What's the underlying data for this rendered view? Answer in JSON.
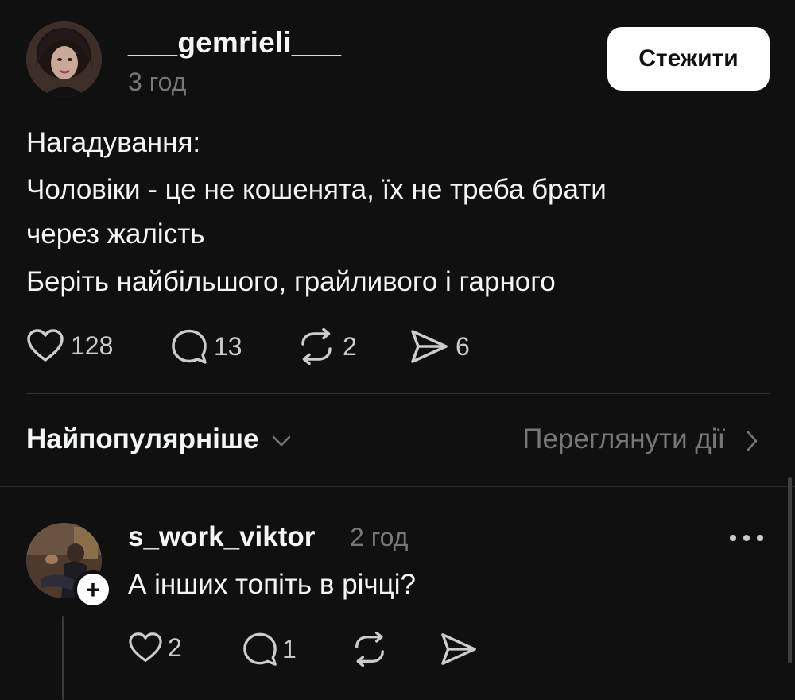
{
  "post": {
    "username": "___gemrieli___",
    "timestamp": "3 год",
    "follow_label": "Стежити",
    "lines": [
      "Нагадування:",
      "Чоловіки - це не кошенята, їх не треба брати",
      "через жалість",
      "Беріть найбільшого, грайливого і гарного"
    ],
    "actions": {
      "likes": "128",
      "comments": "13",
      "reposts": "2",
      "shares": "6"
    }
  },
  "replies_header": {
    "sort_label": "Найпопулярніше",
    "view_activity_label": "Переглянути дії"
  },
  "reply": {
    "username": "s_work_viktor",
    "timestamp": "2 год",
    "text": "А інших топіть в річці?",
    "plus_label": "+",
    "actions": {
      "likes": "2",
      "comments": "1"
    }
  },
  "icons": {
    "like": "heart-icon",
    "comment": "speech-bubble-icon",
    "repost": "repost-icon",
    "share": "paper-plane-icon",
    "more": "more-dots-icon",
    "sort_chevron": "chevron-down-icon",
    "activity_chevron": "chevron-right-icon"
  }
}
